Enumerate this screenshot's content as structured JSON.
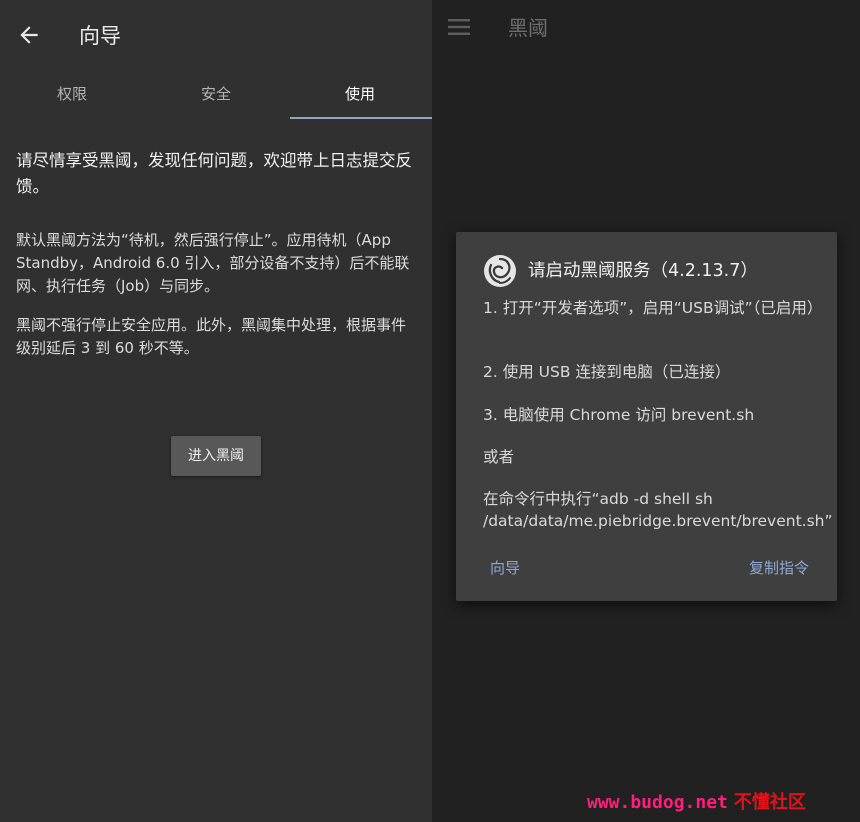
{
  "left": {
    "appbar": {
      "title": "向导"
    },
    "tabs": [
      {
        "label": "权限"
      },
      {
        "label": "安全"
      },
      {
        "label": "使用"
      }
    ],
    "active_tab": 2,
    "paragraphs": [
      "请尽情享受黑阈，发现任何问题，欢迎带上日志提交反馈。",
      "默认黑阈方法为“待机，然后强行停止”。应用待机（App Standby，Android 6.0 引入，部分设备不支持）后不能联网、执行任务（Job）与同步。",
      "黑阈不强行停止安全应用。此外，黑阈集中处理，根据事件级别延后 3 到 60 秒不等。"
    ],
    "enter_button": "进入黑阈"
  },
  "right": {
    "appbar": {
      "title": "黑阈"
    },
    "dialog": {
      "title": "请启动黑阈服务（4.2.13.7）",
      "steps": [
        "1. 打开“开发者选项”，启用“USB调试”（已启用）",
        "2. 使用 USB 连接到电脑（已连接）",
        "3. 电脑使用 Chrome 访问 brevent.sh",
        "或者",
        "在命令行中执行“adb -d shell sh /data/data/me.piebridge.brevent/brevent.sh”"
      ],
      "buttons": {
        "guide": "向导",
        "copy": "复制指令"
      }
    }
  },
  "watermark": {
    "url": "www.budog.net",
    "name": "不懂社区"
  },
  "colors": {
    "left_bg": "#303030",
    "right_bg": "#212121",
    "dialog_bg": "#3f3f3f",
    "accent": "#8fa9cf",
    "tab_indicator": "#90a4c4",
    "watermark_url": "#ff1f7a",
    "watermark_name": "#e0141a"
  }
}
